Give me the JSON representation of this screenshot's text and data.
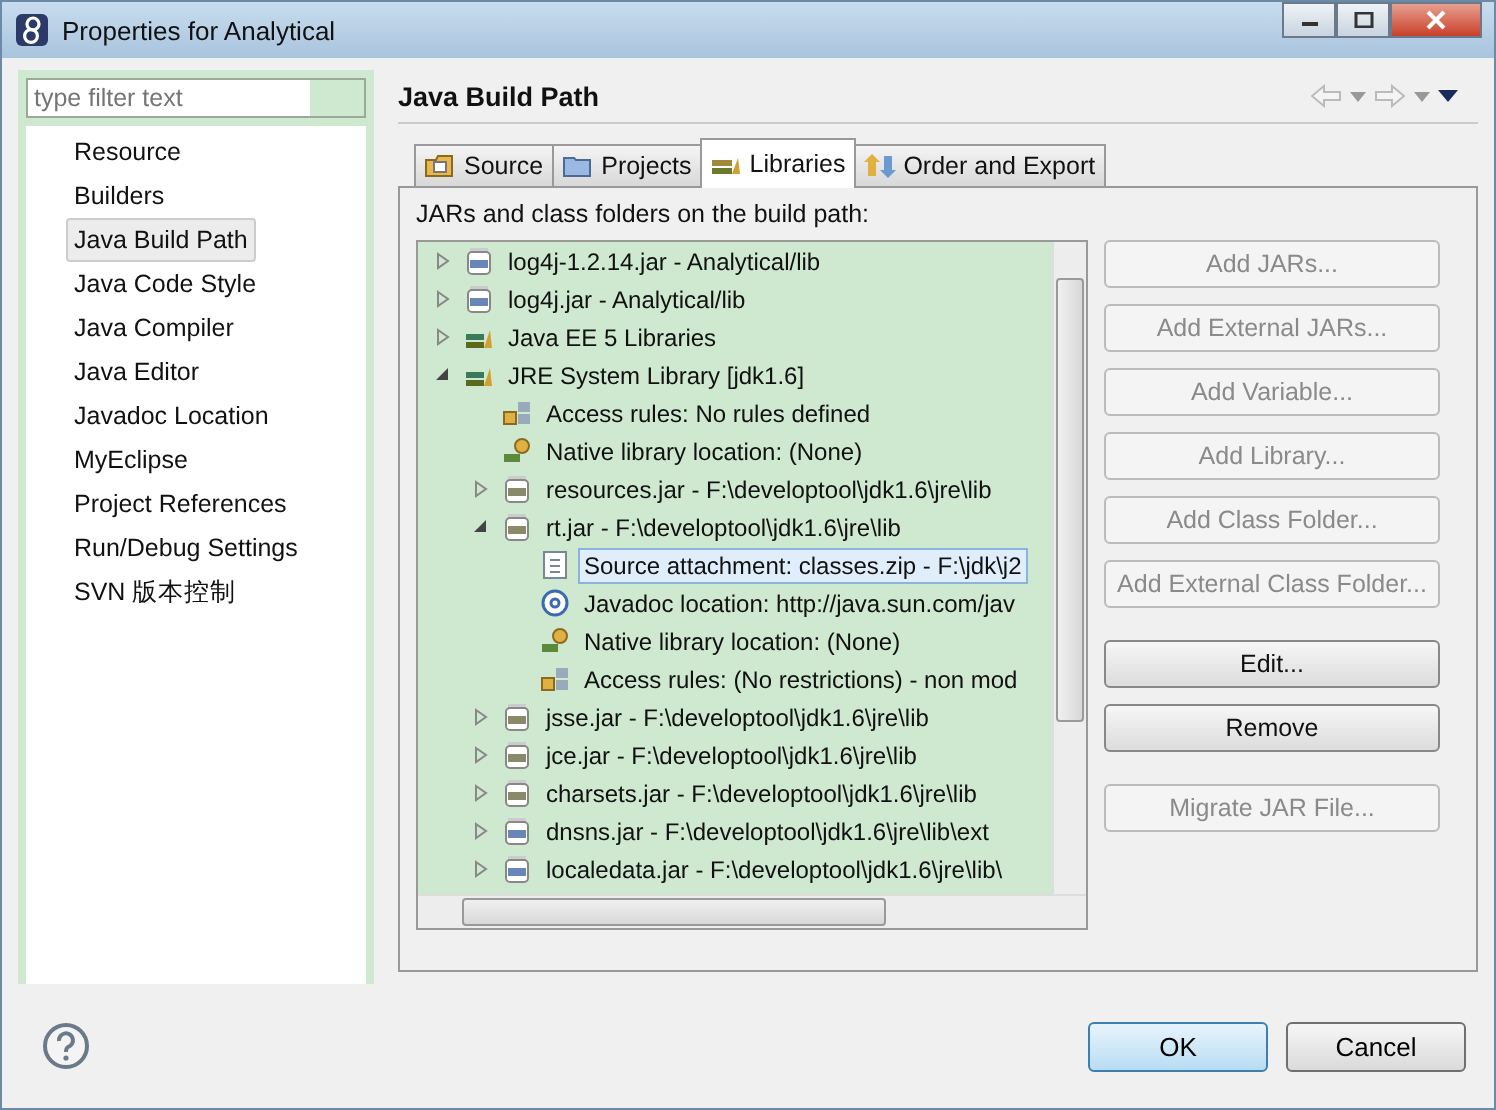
{
  "window": {
    "title": "Properties for Analytical"
  },
  "sidebar": {
    "filter": {
      "placeholder": "type filter text"
    },
    "items": [
      {
        "label": "Resource",
        "selected": false
      },
      {
        "label": "Builders",
        "selected": false
      },
      {
        "label": "Java Build Path",
        "selected": true
      },
      {
        "label": "Java Code Style",
        "selected": false
      },
      {
        "label": "Java Compiler",
        "selected": false
      },
      {
        "label": "Java Editor",
        "selected": false
      },
      {
        "label": "Javadoc Location",
        "selected": false
      },
      {
        "label": "MyEclipse",
        "selected": false
      },
      {
        "label": "Project References",
        "selected": false
      },
      {
        "label": "Run/Debug Settings",
        "selected": false
      },
      {
        "label": "SVN 版本控制",
        "selected": false
      }
    ]
  },
  "page": {
    "title": "Java Build Path"
  },
  "tabs": [
    {
      "label": "Source",
      "kind": "source",
      "selected": false
    },
    {
      "label": "Projects",
      "kind": "projects",
      "selected": false
    },
    {
      "label": "Libraries",
      "kind": "libraries",
      "selected": true
    },
    {
      "label": "Order and Export",
      "kind": "order",
      "selected": false
    }
  ],
  "tree_label": "JARs and class folders on the build path:",
  "tree": [
    {
      "label": "log4j-1.2.14.jar - Analytical/lib",
      "kind": "jar",
      "expanded": false,
      "selected": false
    },
    {
      "label": "log4j.jar - Analytical/lib",
      "kind": "jar",
      "expanded": false,
      "selected": false
    },
    {
      "label": "Java EE 5 Libraries",
      "kind": "library",
      "expanded": false,
      "selected": false
    },
    {
      "label": "JRE System Library [jdk1.6]",
      "kind": "library",
      "expanded": true,
      "selected": false,
      "children": [
        {
          "label": "Access rules: No rules defined",
          "kind": "access",
          "selected": false
        },
        {
          "label": "Native library location: (None)",
          "kind": "native",
          "selected": false
        },
        {
          "label": "resources.jar - F:\\developtool\\jdk1.6\\jre\\lib",
          "kind": "sysjar",
          "expanded": false,
          "selected": false
        },
        {
          "label": "rt.jar - F:\\developtool\\jdk1.6\\jre\\lib",
          "kind": "sysjar",
          "expanded": true,
          "selected": false,
          "children": [
            {
              "label": "Source attachment: classes.zip - F:\\jdk\\j2",
              "kind": "source",
              "selected": true
            },
            {
              "label": "Javadoc location: http://java.sun.com/jav",
              "kind": "javadoc",
              "selected": false
            },
            {
              "label": "Native library location: (None)",
              "kind": "native",
              "selected": false
            },
            {
              "label": "Access rules: (No restrictions) - non mod",
              "kind": "access",
              "selected": false
            }
          ]
        },
        {
          "label": "jsse.jar - F:\\developtool\\jdk1.6\\jre\\lib",
          "kind": "sysjar",
          "expanded": false,
          "selected": false
        },
        {
          "label": "jce.jar - F:\\developtool\\jdk1.6\\jre\\lib",
          "kind": "sysjar",
          "expanded": false,
          "selected": false
        },
        {
          "label": "charsets.jar - F:\\developtool\\jdk1.6\\jre\\lib",
          "kind": "sysjar",
          "expanded": false,
          "selected": false
        },
        {
          "label": "dnsns.jar - F:\\developtool\\jdk1.6\\jre\\lib\\ext",
          "kind": "jar",
          "expanded": false,
          "selected": false
        },
        {
          "label": "localedata.jar - F:\\developtool\\jdk1.6\\jre\\lib\\",
          "kind": "jar",
          "expanded": false,
          "selected": false
        }
      ]
    }
  ],
  "buttons": [
    {
      "label": "Add JARs...",
      "disabled": true,
      "kind": "plain"
    },
    {
      "label": "Add External JARs...",
      "disabled": true,
      "kind": "plain"
    },
    {
      "label": "Add Variable...",
      "disabled": true,
      "kind": "plain"
    },
    {
      "label": "Add Library...",
      "disabled": true,
      "kind": "plain"
    },
    {
      "label": "Add Class Folder...",
      "disabled": true,
      "kind": "plain"
    },
    {
      "label": "Add External Class Folder...",
      "disabled": true,
      "kind": "plain"
    },
    {
      "label": "Edit...",
      "disabled": false,
      "kind": "gap"
    },
    {
      "label": "Remove",
      "disabled": false,
      "kind": "plain"
    },
    {
      "label": "Migrate JAR File...",
      "disabled": true,
      "kind": "gap"
    }
  ],
  "footer": {
    "ok": "OK",
    "cancel": "Cancel"
  }
}
